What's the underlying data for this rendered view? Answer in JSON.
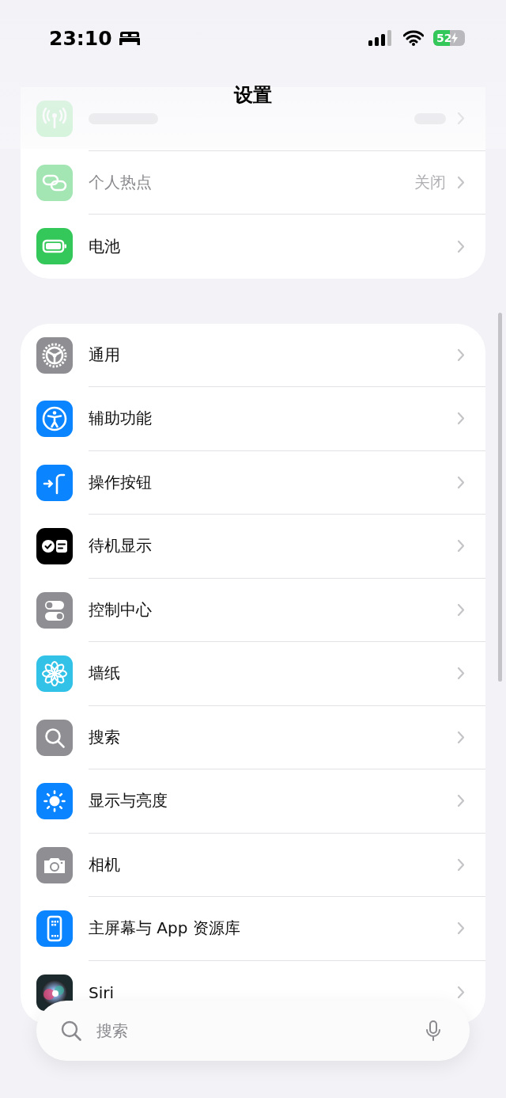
{
  "status_bar": {
    "time": "23:10",
    "battery": {
      "text": "52",
      "level": 0.52,
      "charging": true
    }
  },
  "title": "设置",
  "groups": [
    {
      "rows": [
        {
          "kind": "obscured"
        },
        {
          "label": "个人热点",
          "value": "关闭",
          "disabled": true
        },
        {
          "label": "电池",
          "disabled": false
        }
      ]
    },
    {
      "rows": [
        {
          "label": "通用",
          "disabled": false
        },
        {
          "label": "辅助功能",
          "disabled": false
        },
        {
          "label": "操作按钮",
          "disabled": false
        },
        {
          "label": "待机显示",
          "disabled": false
        },
        {
          "label": "控制中心",
          "disabled": false
        },
        {
          "label": "墙纸",
          "disabled": false
        },
        {
          "label": "搜索",
          "disabled": false
        },
        {
          "label": "显示与亮度",
          "disabled": false
        },
        {
          "label": "相机",
          "disabled": false
        },
        {
          "label": "主屏幕与 App 资源库",
          "disabled": false
        },
        {
          "label": "Siri",
          "disabled": false
        }
      ]
    }
  ],
  "search": {
    "placeholder": "搜索"
  }
}
